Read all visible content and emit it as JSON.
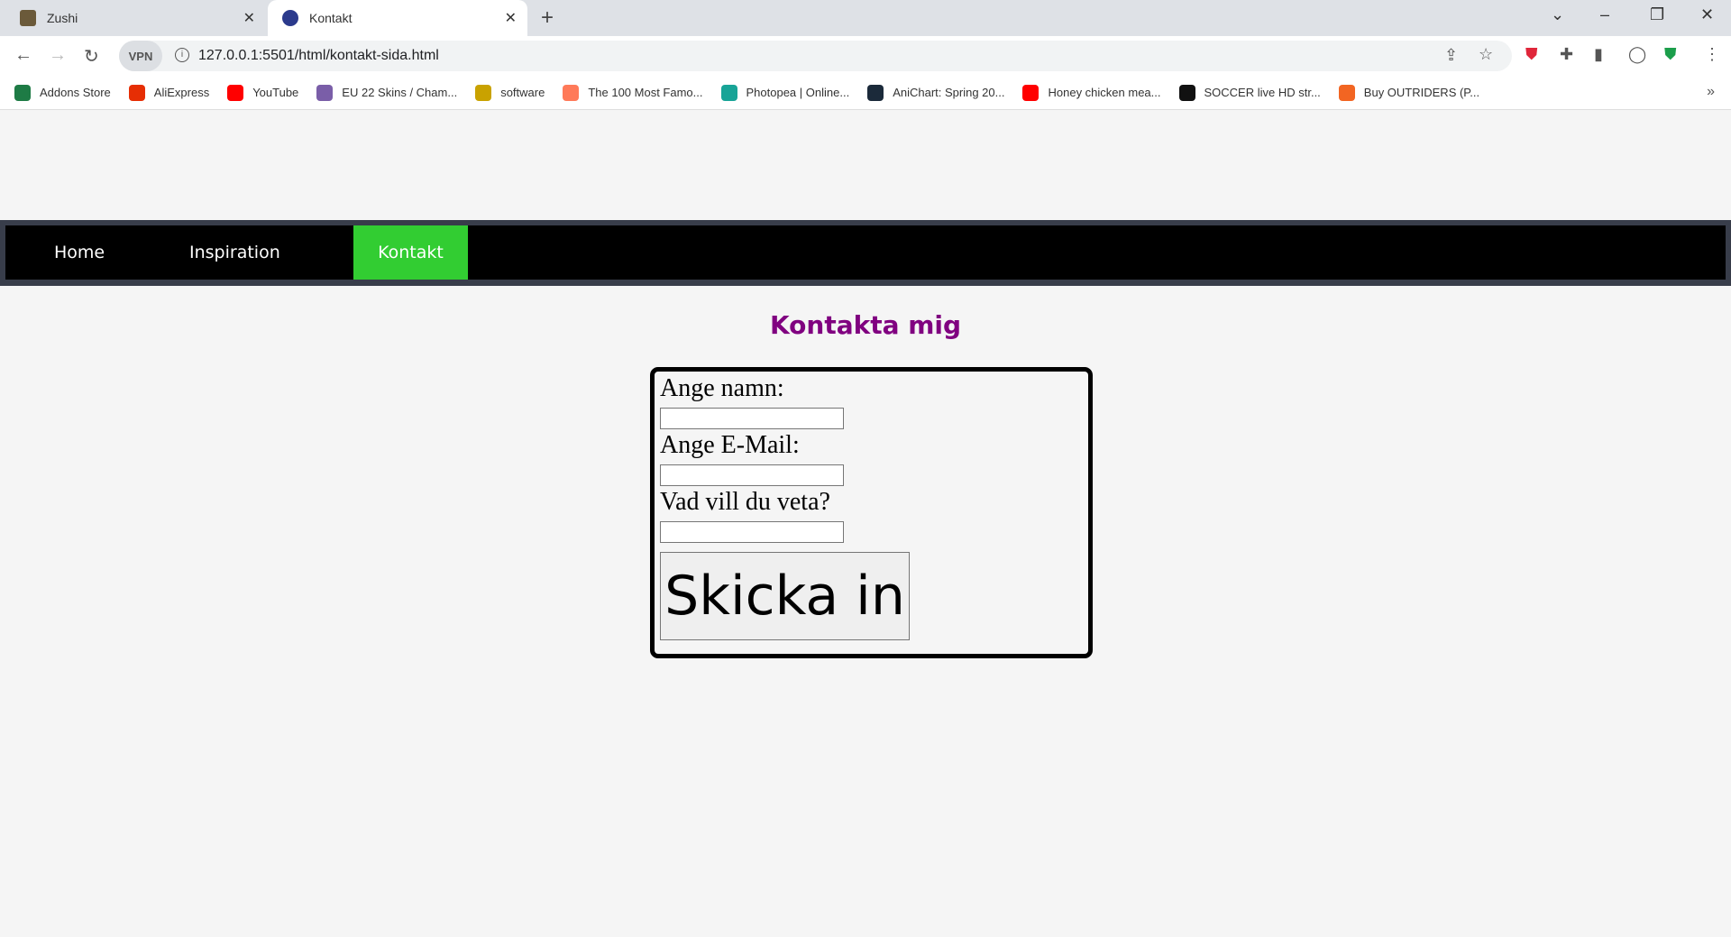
{
  "browser": {
    "tabs": [
      {
        "title": "Zushi",
        "active": false
      },
      {
        "title": "Kontakt",
        "active": true
      }
    ],
    "url": "127.0.0.1:5501/html/kontakt-sida.html",
    "vpn_label": "VPN",
    "bookmarks": [
      {
        "label": "Addons Store",
        "color": "#1e7b45"
      },
      {
        "label": "AliExpress",
        "color": "#e62e04"
      },
      {
        "label": "YouTube",
        "color": "#ff0000"
      },
      {
        "label": "EU 22 Skins / Cham...",
        "color": "#7a5ea8"
      },
      {
        "label": "software",
        "color": "#c9a200"
      },
      {
        "label": "The 100 Most Famo...",
        "color": "#ff7a59"
      },
      {
        "label": "Photopea | Online...",
        "color": "#18a497"
      },
      {
        "label": "AniChart: Spring 20...",
        "color": "#1b2a3a"
      },
      {
        "label": "Honey chicken mea...",
        "color": "#ff0000"
      },
      {
        "label": "SOCCER live HD str...",
        "color": "#111111"
      },
      {
        "label": "Buy OUTRIDERS (P...",
        "color": "#f26522"
      }
    ]
  },
  "nav": {
    "items": [
      {
        "label": "Home"
      },
      {
        "label": "Inspiration"
      },
      {
        "label": "Kontakt",
        "active": true
      }
    ],
    "active_color": "#32cd32"
  },
  "page": {
    "title": "Kontakta mig",
    "title_color": "#800080",
    "form": {
      "name_label": "Ange namn:",
      "name_value": "",
      "email_label": "Ange E-Mail:",
      "email_value": "",
      "question_label": "Vad vill du veta?",
      "question_value": "",
      "submit_label": "Skicka in"
    }
  }
}
